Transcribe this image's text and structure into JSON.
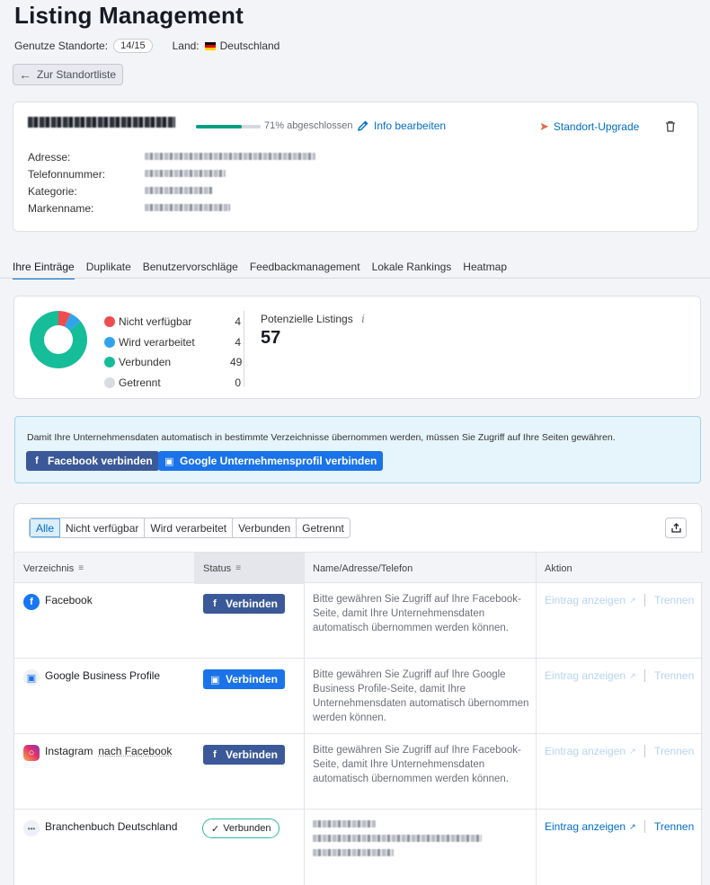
{
  "page": {
    "title": "Listing Management"
  },
  "meta": {
    "locations_label": "Genutze Standorte:",
    "locations_value": "14/15",
    "country_label": "Land:",
    "country_value": "Deutschland"
  },
  "back_button": {
    "label": "Zur Standortliste"
  },
  "location": {
    "progress_text": "71% abgeschlossen",
    "progress_fraction": 0.71,
    "edit_label": "Info bearbeiten",
    "upgrade_label": "Standort-Upgrade",
    "fields": [
      {
        "label": "Adresse:"
      },
      {
        "label": "Telefonnummer:"
      },
      {
        "label": "Kategorie:"
      },
      {
        "label": "Markenname:"
      }
    ]
  },
  "tabs": [
    {
      "label": "Ihre Einträge",
      "active": true
    },
    {
      "label": "Duplikate"
    },
    {
      "label": "Benutzervorschläge"
    },
    {
      "label": "Feedbackmanagement"
    },
    {
      "label": "Lokale Rankings"
    },
    {
      "label": "Heatmap"
    }
  ],
  "stats": {
    "legend": [
      {
        "name": "Nicht verfügbar",
        "count": "4",
        "color": "#ef4c4f"
      },
      {
        "name": "Wird verarbeitet",
        "count": "4",
        "color": "#2fa4ea"
      },
      {
        "name": "Verbunden",
        "count": "49",
        "color": "#15bd98"
      },
      {
        "name": "Getrennt",
        "count": "0",
        "color": "#d9dbe3"
      }
    ],
    "potential_label": "Potenzielle Listings",
    "potential_value": "57"
  },
  "info": {
    "text": "Damit Ihre Unternehmensdaten automatisch in bestimmte Verzeichnisse übernommen werden, müssen Sie Zugriff auf Ihre Seiten gewähren.",
    "facebook_button": "Facebook verbinden",
    "google_button": "Google Unternehmensprofil verbinden"
  },
  "table": {
    "filters": [
      "Alle",
      "Nicht verfügbar",
      "Wird verarbeitet",
      "Verbunden",
      "Getrennt"
    ],
    "columns": [
      "Verzeichnis",
      "Status",
      "Name/Adresse/Telefon",
      "Aktion"
    ],
    "rows": [
      {
        "directory": "Facebook",
        "status": "Verbinden",
        "description": "Bitte gewähren Sie Zugriff auf Ihre Facebook-Seite, damit Ihre Unternehmensdaten automatisch übernommen werden können.",
        "view_label": "Eintrag anzeigen",
        "remove_label": "Trennen"
      },
      {
        "directory": "Google Business Profile",
        "status": "Verbinden",
        "description": "Bitte gewähren Sie Zugriff auf Ihre Google Business Profile-Seite, damit Ihre Unternehmensdaten automatisch übernommen werden können.",
        "view_label": "Eintrag anzeigen",
        "remove_label": "Trennen"
      },
      {
        "directory": "Instagram",
        "directory_note": "nach Facebook",
        "status": "Verbinden",
        "description": "Bitte gewähren Sie Zugriff auf Ihre Facebook-Seite, damit Ihre Unternehmensdaten automatisch übernommen werden können.",
        "view_label": "Eintrag anzeigen",
        "remove_label": "Trennen"
      },
      {
        "directory": "Branchenbuch Deutschland",
        "status": "Verbunden",
        "view_label": "Eintrag anzeigen",
        "remove_label": "Trennen"
      }
    ]
  }
}
